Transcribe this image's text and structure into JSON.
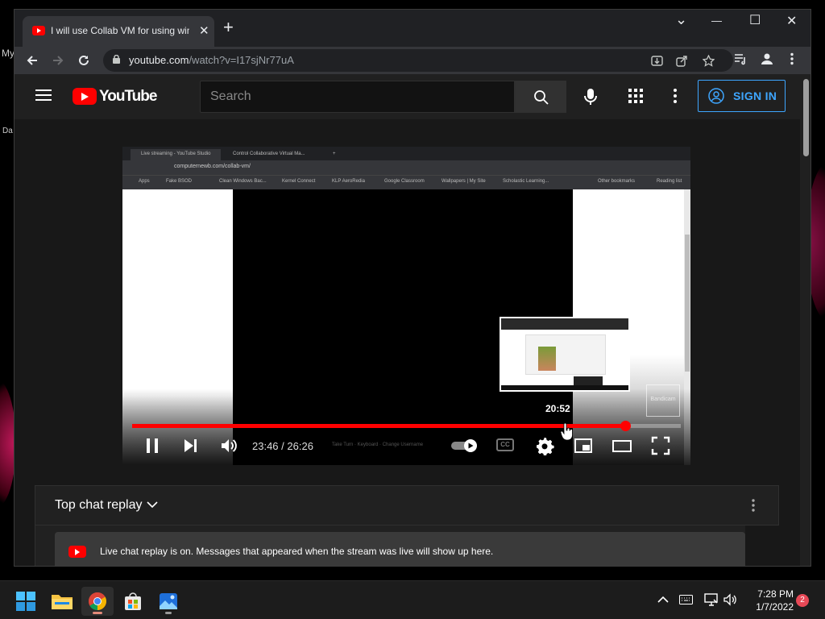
{
  "desktop": {
    "texts": [
      "My",
      "Da"
    ]
  },
  "browser": {
    "tab_title": "I will use Collab VM for using windows",
    "tab_close": "✕",
    "new_tab": "+",
    "url_host": "youtube.com",
    "url_path": "/watch?v=I17sjNr77uA",
    "window_controls": {
      "chevron": "⌄",
      "minimize": "—",
      "maximize": "☐",
      "close": "✕"
    }
  },
  "youtube": {
    "logo_text": "YouTube",
    "search_placeholder": "Search",
    "sign_in": "SIGN IN"
  },
  "player": {
    "inner_tabs": [
      "Live streaming - YouTube Studio",
      "Control Collaborative Virtual Ma..."
    ],
    "inner_url": "computernewb.com/collab-vm/",
    "inner_bookmarks": [
      "Apps",
      "Fake BSOD",
      "Clean Windows Bac...",
      "Kernel Connect",
      "KLP AeroRedia",
      "Google Classroom",
      "Wallpapers | My Site",
      "Scholastic Learning...",
      "Other bookmarks",
      "Reading list"
    ],
    "inner_chapters": "Take Turn · Keyboard · Change Username",
    "preview_time": "20:52",
    "current_time": "23:46",
    "duration": "26:26",
    "time_separator": " / ",
    "progress_fraction": 0.898,
    "watermark_text": "Bandicam",
    "cc_label": "CC"
  },
  "chat": {
    "title": "Top chat replay",
    "banner_message": "Live chat replay is on. Messages that appeared when the stream was live will show up here."
  },
  "taskbar": {
    "time": "7:28 PM",
    "date": "1/7/2022",
    "notifications": "2"
  },
  "colors": {
    "youtube_red": "#ff0000",
    "signin_blue": "#3ea6ff",
    "chrome_dark": "#202124"
  }
}
